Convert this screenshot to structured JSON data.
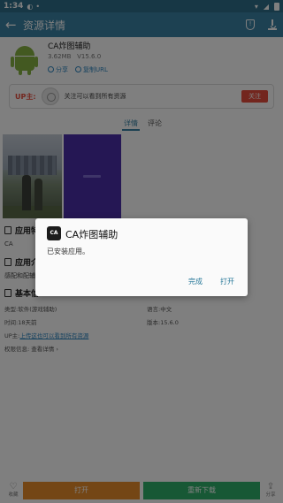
{
  "status_bar": {
    "time": "1:34"
  },
  "app_bar": {
    "title": "资源详情"
  },
  "app": {
    "name": "CA炸图辅助",
    "size": "3.62MB",
    "version": "V15.6.0",
    "share_label": "分享",
    "copy_url_label": "复制URL"
  },
  "uploader": {
    "label": "UP主:",
    "text": "关注可以看到所有资源",
    "follow_label": "关注"
  },
  "tabs": {
    "detail": "详情",
    "comment": "评论"
  },
  "sections": {
    "apps_title": "应用特",
    "apps_text": "CA",
    "intro_title": "应用介",
    "intro_text": "感配和配辅",
    "basic_title": "基本信"
  },
  "info": {
    "type": "类型:软件(游戏辅助)",
    "language": "语言:中文",
    "time": "时间:18天前",
    "version": "版本:15.6.0",
    "uploader_prefix": "UP主:",
    "uploader_link": "上传这也可以看到所有资源",
    "permissions": "权限信息:  查看详情 ›"
  },
  "bottom": {
    "favorite": "收藏",
    "open": "打开",
    "redownload": "重新下载",
    "share": "分享"
  },
  "dialog": {
    "icon_text": "CA",
    "title": "CA炸图辅助",
    "message": "已安装应用。",
    "done_label": "完成",
    "open_label": "打开"
  },
  "colors": {
    "app_bar": "#3a82a5",
    "accent": "#2e86c1",
    "follow": "#e74c3c",
    "open_button": "#e88d2a",
    "redownload_button": "#2fb06a"
  }
}
